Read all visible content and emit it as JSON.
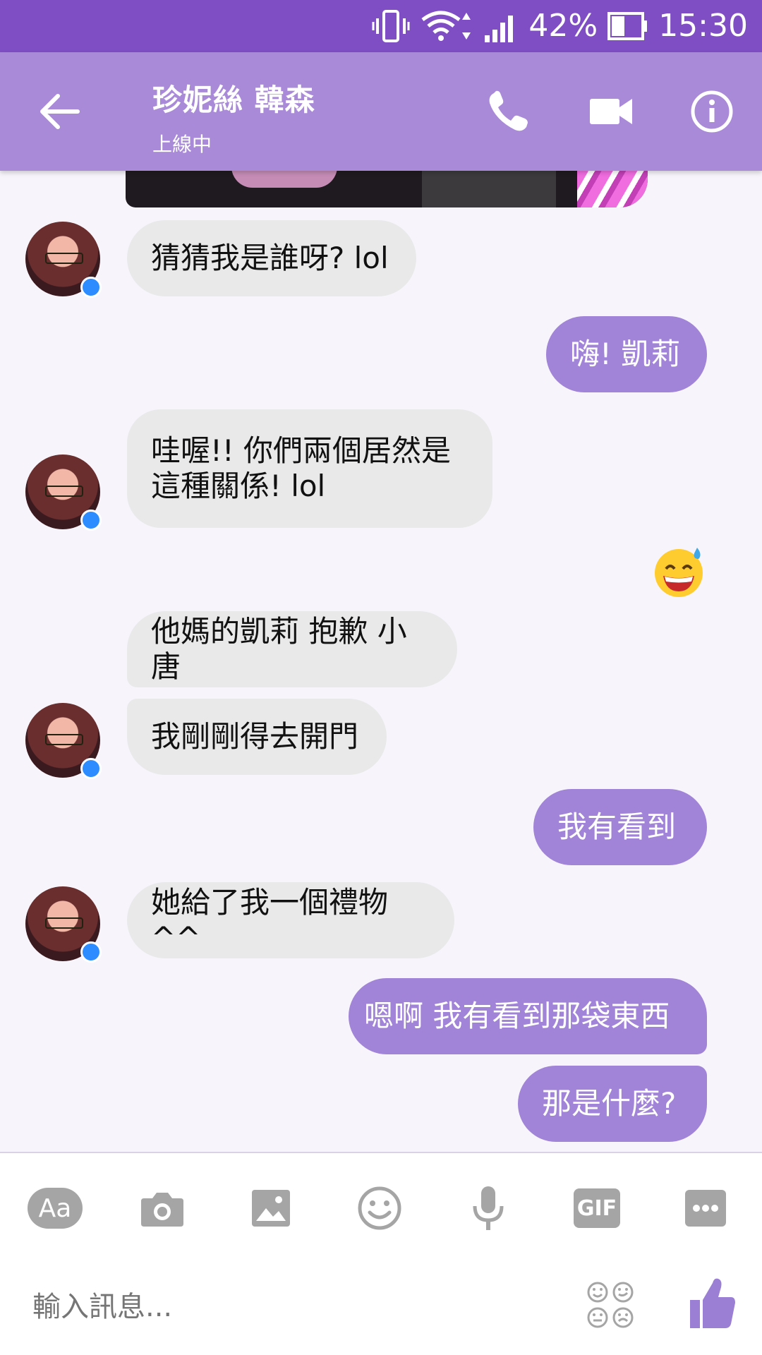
{
  "status_bar": {
    "battery_percent": "42%",
    "time": "15:30",
    "icons": [
      "vibrate-icon",
      "wifi-icon",
      "signal-icon",
      "battery-icon"
    ]
  },
  "header": {
    "contact_name": "珍妮絲 韓森",
    "contact_status": "上線中",
    "icons": [
      "back-arrow-icon",
      "phone-icon",
      "video-camera-icon",
      "info-icon"
    ]
  },
  "messages": [
    {
      "direction": "incoming",
      "text": "猜猜我是誰呀? lol"
    },
    {
      "direction": "outgoing",
      "text": "嗨! 凱莉"
    },
    {
      "direction": "incoming",
      "line1": "哇喔!! 你們兩個居然是",
      "line2": "這種關係! lol"
    },
    {
      "direction": "outgoing",
      "emoji": "sweat-smile-emoji"
    },
    {
      "direction": "incoming",
      "text": "他媽的凱莉 抱歉 小唐"
    },
    {
      "direction": "incoming",
      "text": "我剛剛得去開門"
    },
    {
      "direction": "outgoing",
      "text": "我有看到"
    },
    {
      "direction": "incoming",
      "text": "她給了我一個禮物^^"
    },
    {
      "direction": "outgoing",
      "text": "嗯啊 我有看到那袋東西"
    },
    {
      "direction": "outgoing",
      "text": "那是什麼?"
    }
  ],
  "toolbar": {
    "aa_label": "Aa",
    "gif_label": "GIF",
    "icons": [
      "camera-icon",
      "image-icon",
      "emoji-icon",
      "microphone-icon",
      "more-icon"
    ],
    "input_placeholder": "輸入訊息...",
    "like_icon": "thumbs-up-icon"
  },
  "colors": {
    "status_bar": "#7f4ec4",
    "app_bar": "#a98ad9",
    "outgoing_bubble": "#a184d8",
    "incoming_bubble": "#e9e9ea",
    "toolbar_icon": "#a5a5a5",
    "like_icon": "#9b7fd4"
  }
}
